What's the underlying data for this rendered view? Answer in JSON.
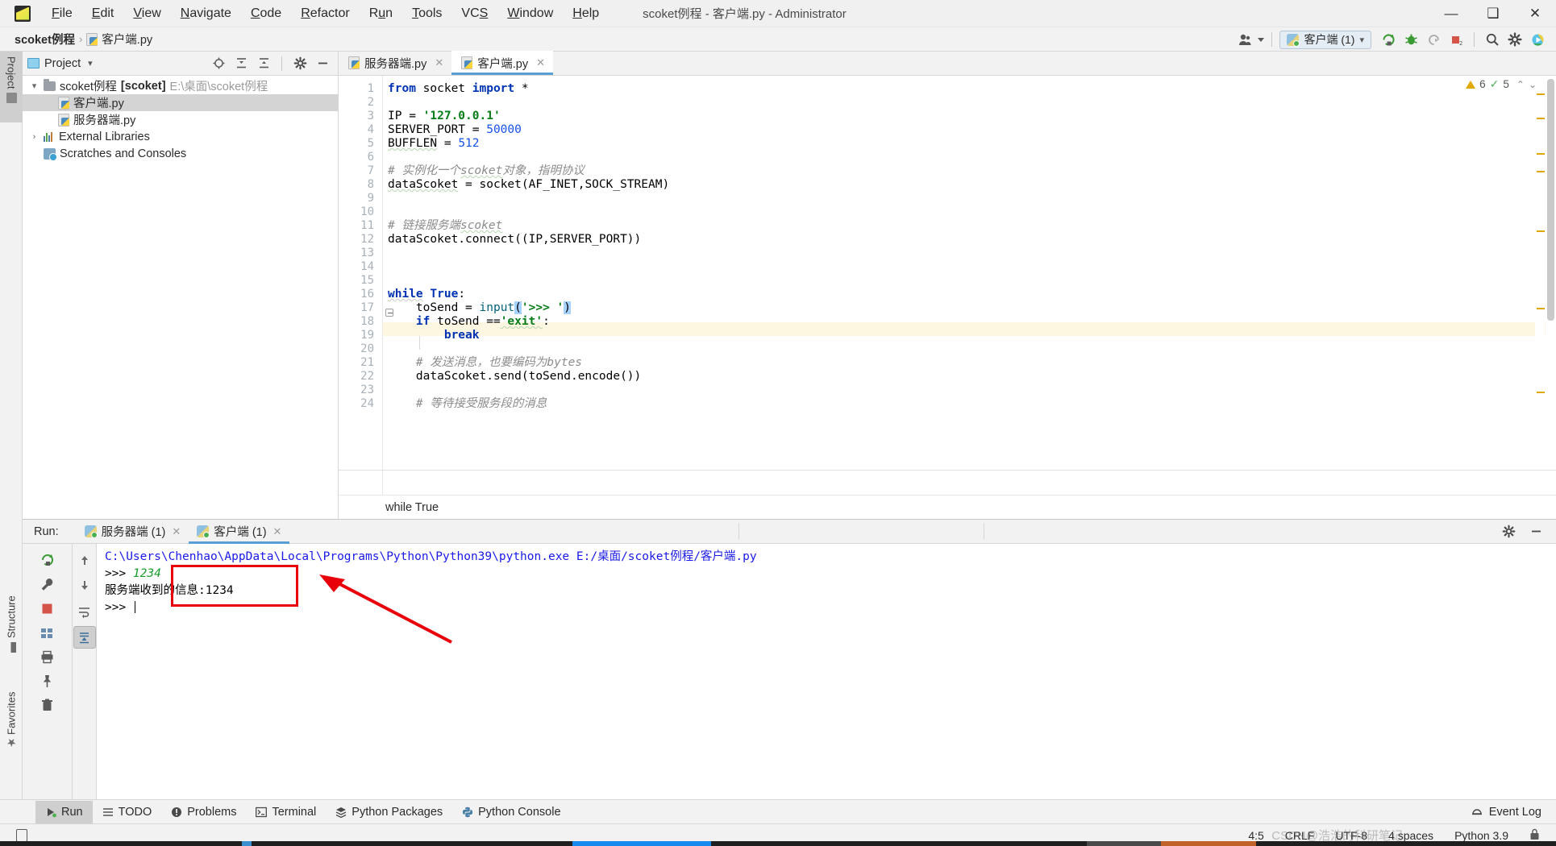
{
  "window": {
    "title": "scoket例程 - 客户端.py - Administrator",
    "app_icon": "pycharm-logo-icon",
    "controls": {
      "minimize": "—",
      "maximize": "❐",
      "close": "✕"
    }
  },
  "menubar": {
    "items": [
      "File",
      "Edit",
      "View",
      "Navigate",
      "Code",
      "Refactor",
      "Run",
      "Tools",
      "VCS",
      "Window",
      "Help"
    ]
  },
  "breadcrumb": {
    "project": "scoket例程",
    "separator": "›",
    "file": "客户端.py"
  },
  "toolbar": {
    "account_label": "account-icon",
    "run_config": {
      "label": "客户端 (1)",
      "icon": "python-config-icon",
      "chevron": "▾"
    },
    "buttons": [
      {
        "name": "run-button",
        "glyph": "▶"
      },
      {
        "name": "debug-button",
        "glyph": "🐞"
      },
      {
        "name": "coverage-button",
        "glyph": "▷"
      },
      {
        "name": "stop-button",
        "glyph": "■"
      },
      {
        "name": "search-everywhere-button",
        "glyph": "🔍"
      },
      {
        "name": "settings-button",
        "glyph": "⚙"
      },
      {
        "name": "updates-button",
        "glyph": "▶"
      }
    ]
  },
  "left_strip": {
    "tabs": [
      {
        "label": "Project",
        "selected": true
      },
      {
        "label": "Structure",
        "selected": false
      },
      {
        "label": "Favorites",
        "selected": false
      }
    ]
  },
  "project_panel": {
    "header": {
      "title": "Project",
      "chevron": "▾"
    },
    "header_icons": [
      "locate-icon",
      "expand-all-icon",
      "collapse-all-icon",
      "gear-icon",
      "hide-icon"
    ],
    "tree": [
      {
        "indent": 0,
        "chevron": "⌄",
        "icon": "folder-icon",
        "label": "scoket例程",
        "module": "[scoket]",
        "path": "E:\\桌面\\scoket例程",
        "selected": false
      },
      {
        "indent": 1,
        "chevron": "",
        "icon": "python-file-icon",
        "label": "客户端.py",
        "module": "",
        "path": "",
        "selected": true
      },
      {
        "indent": 1,
        "chevron": "",
        "icon": "python-file-icon",
        "label": "服务器端.py",
        "module": "",
        "path": "",
        "selected": false
      },
      {
        "indent": 0,
        "chevron": "›",
        "icon": "external-libraries-icon",
        "label": "External Libraries",
        "module": "",
        "path": "",
        "selected": false
      },
      {
        "indent": 0,
        "chevron": "",
        "icon": "scratches-icon",
        "label": "Scratches and Consoles",
        "module": "",
        "path": "",
        "selected": false
      }
    ]
  },
  "editor": {
    "tabs": [
      {
        "label": "服务器端.py",
        "icon": "python-file-icon",
        "active": false,
        "close": "✕"
      },
      {
        "label": "客户端.py",
        "icon": "python-file-icon",
        "active": true,
        "close": "✕"
      }
    ],
    "inspection_hud": {
      "warnings": "6",
      "ok": "5",
      "up": "⌃",
      "down": "⌄"
    },
    "breadcrumb_bottom": "while True",
    "lines": [
      {
        "n": 1,
        "text": "from socket import *"
      },
      {
        "n": 2,
        "text": ""
      },
      {
        "n": 3,
        "text": "IP = '127.0.0.1'"
      },
      {
        "n": 4,
        "text": "SERVER_PORT = 50000"
      },
      {
        "n": 5,
        "text": "BUFFLEN = 512"
      },
      {
        "n": 6,
        "text": ""
      },
      {
        "n": 7,
        "text": "# 实例化一个scoket对象，指明协议"
      },
      {
        "n": 8,
        "text": "dataScoket = socket(AF_INET,SOCK_STREAM)"
      },
      {
        "n": 9,
        "text": ""
      },
      {
        "n": 10,
        "text": ""
      },
      {
        "n": 11,
        "text": "# 链接服务端scoket"
      },
      {
        "n": 12,
        "text": "dataScoket.connect((IP,SERVER_PORT))"
      },
      {
        "n": 13,
        "text": ""
      },
      {
        "n": 14,
        "text": ""
      },
      {
        "n": 15,
        "text": ""
      },
      {
        "n": 16,
        "text": "while True:"
      },
      {
        "n": 17,
        "text": "    toSend = input('>>> ')"
      },
      {
        "n": 18,
        "text": "    if toSend =='exit':"
      },
      {
        "n": 19,
        "text": "        break"
      },
      {
        "n": 20,
        "text": ""
      },
      {
        "n": 21,
        "text": "    # 发送消息，也要编码为bytes"
      },
      {
        "n": 22,
        "text": "    dataScoket.send(toSend.encode())"
      },
      {
        "n": 23,
        "text": ""
      },
      {
        "n": 24,
        "text": "    # 等待接受服务段的消息"
      }
    ]
  },
  "run_panel": {
    "label": "Run:",
    "tabs": [
      {
        "label": "服务器端 (1)",
        "icon": "python-run-icon",
        "active": false,
        "close": "✕"
      },
      {
        "label": "客户端 (1)",
        "icon": "python-run-icon",
        "active": true,
        "close": "✕"
      }
    ],
    "toolbar_icons": [
      "rerun-icon",
      "wrench-icon",
      "stop-icon",
      "up-icon",
      "down-icon",
      "soft-wrap-icon",
      "scroll-to-end-icon",
      "grid-icon",
      "print-icon",
      "pin-icon",
      "trash-icon"
    ],
    "right_icons": [
      "gear-icon",
      "hide-icon"
    ],
    "console": {
      "command": "C:\\Users\\Chenhao\\AppData\\Local\\Programs\\Python\\Python39\\python.exe E:/桌面/scoket例程/客户端.py",
      "prompt1": ">>> ",
      "input1": "1234",
      "reply": "服务端收到的信息:1234",
      "prompt2": ">>> "
    },
    "annotation": {
      "box_color": "#e8000a",
      "arrow_color": "#e8000a"
    }
  },
  "bottom_tabs": [
    {
      "label": "Run",
      "icon": "run-icon",
      "selected": true
    },
    {
      "label": "TODO",
      "icon": "todo-icon",
      "selected": false
    },
    {
      "label": "Problems",
      "icon": "problems-icon",
      "selected": false
    },
    {
      "label": "Terminal",
      "icon": "terminal-icon",
      "selected": false
    },
    {
      "label": "Python Packages",
      "icon": "packages-icon",
      "selected": false
    },
    {
      "label": "Python Console",
      "icon": "python-console-icon",
      "selected": false
    }
  ],
  "event_log": {
    "label": "Event Log",
    "icon": "event-log-icon"
  },
  "statusbar": {
    "position": "4:5",
    "line_sep": "CRLF",
    "encoding": "UTF-8",
    "indent": "4 spaces",
    "interpreter": "Python 3.9",
    "lock_icon": "lock-icon"
  },
  "watermark": "CSDN@浩浩的科研笔记",
  "colors": {
    "accent": "#5a9fd4",
    "keyword": "#0033b3",
    "string": "#067d17",
    "number": "#1750eb",
    "comment": "#8c8c8c",
    "selection": "#a6d2ff",
    "current_line": "#fdf7e2",
    "annotation_red": "#e8000a",
    "console_path": "#1a1ae6",
    "console_green": "#1a9b2e"
  }
}
